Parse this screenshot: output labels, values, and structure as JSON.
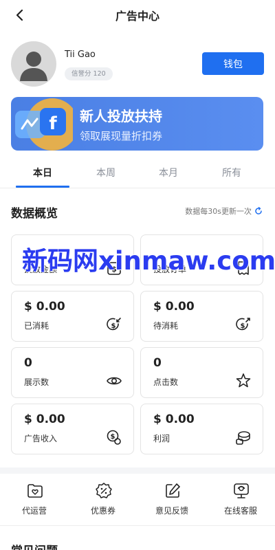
{
  "header": {
    "title": "广告中心",
    "back_icon": "chevron-left-icon"
  },
  "profile": {
    "username": "Tii Gao",
    "credit": "信誉分 120",
    "wallet_label": "钱包",
    "avatar_icon": "user-avatar-icon"
  },
  "banner": {
    "title": "新人投放扶持",
    "subtitle": "领取展现量折扣券",
    "art_letter": "f"
  },
  "tabs": [
    {
      "label": "本日",
      "active": true
    },
    {
      "label": "本周",
      "active": false
    },
    {
      "label": "本月",
      "active": false
    },
    {
      "label": "所有",
      "active": false
    }
  ],
  "overview": {
    "title": "数据概览",
    "update_note": "数据每30s更新一次",
    "refresh_icon": "refresh-icon"
  },
  "cards": [
    {
      "value": "",
      "label": "投放金额",
      "icon": "dollar-box-icon"
    },
    {
      "value": "",
      "label": "投放订单",
      "icon": "receipt-icon"
    },
    {
      "value": "$ 0.00",
      "label": "已消耗",
      "icon": "coin-in-icon"
    },
    {
      "value": "$ 0.00",
      "label": "待消耗",
      "icon": "coin-out-icon"
    },
    {
      "value": "0",
      "label": "展示数",
      "icon": "eye-icon"
    },
    {
      "value": "0",
      "label": "点击数",
      "icon": "star-click-icon"
    },
    {
      "value": "$ 0.00",
      "label": "广告收入",
      "icon": "coin-stack-icon"
    },
    {
      "value": "$ 0.00",
      "label": "利润",
      "icon": "profit-coins-icon"
    }
  ],
  "quick_actions": [
    {
      "label": "代运营",
      "icon": "heart-folder-icon"
    },
    {
      "label": "优惠券",
      "icon": "discount-badge-icon"
    },
    {
      "label": "意见反馈",
      "icon": "edit-icon"
    },
    {
      "label": "在线客服",
      "icon": "support-monitor-icon"
    }
  ],
  "faq": {
    "title": "常见问题"
  },
  "watermark": "新码网xinmaw.com",
  "colors": {
    "accent": "#1f6ff0",
    "banner": "#4f84e8",
    "text": "#222222",
    "muted": "#8a8f99"
  }
}
